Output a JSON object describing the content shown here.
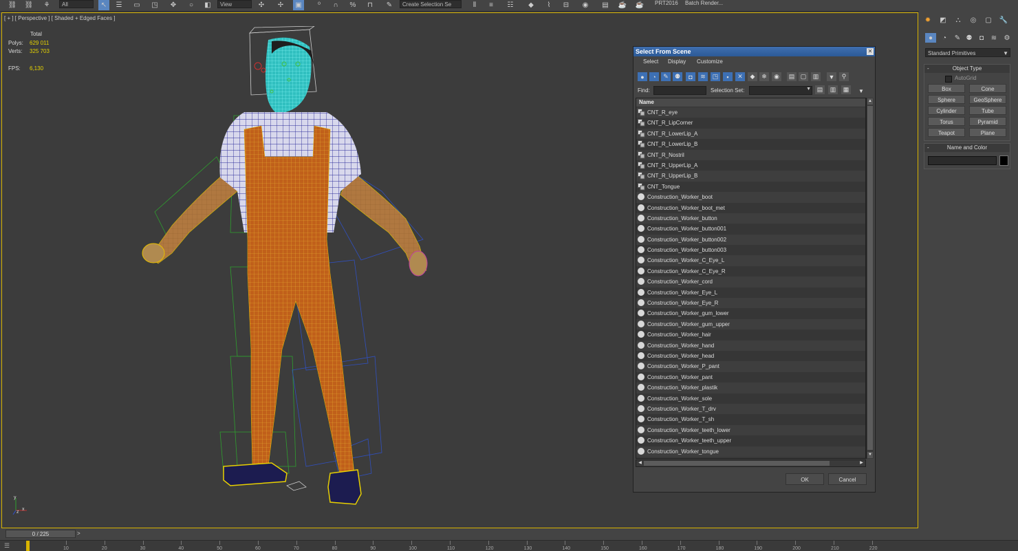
{
  "toolbar": {
    "selection_filter": "All",
    "view_dropdown": "View",
    "named_selection": "Create Selection Se",
    "prt_label": "PRT2016",
    "batch_render": "Batch Render..."
  },
  "viewport": {
    "label": "[ + ] [ Perspective ] [ Shaded + Edged Faces ]",
    "stats": {
      "total_label": "Total",
      "polys_label": "Polys:",
      "polys_value": "629 011",
      "verts_label": "Verts:",
      "verts_value": "325 703",
      "fps_label": "FPS:",
      "fps_value": "6,130"
    },
    "axis": {
      "y": "y",
      "x": "x",
      "z": "z"
    }
  },
  "command_panel": {
    "category_dropdown": "Standard Primitives",
    "object_type": {
      "title": "Object Type",
      "autogrid": "AutoGrid",
      "buttons": [
        "Box",
        "Cone",
        "Sphere",
        "GeoSphere",
        "Cylinder",
        "Tube",
        "Torus",
        "Pyramid",
        "Teapot",
        "Plane"
      ]
    },
    "name_and_color": {
      "title": "Name and Color"
    }
  },
  "dialog": {
    "title": "Select From Scene",
    "menus": [
      "Select",
      "Display",
      "Customize"
    ],
    "find_label": "Find:",
    "selection_set_label": "Selection Set:",
    "column_name": "Name",
    "items": [
      {
        "name": "CNT_R_eye",
        "kind": "helper"
      },
      {
        "name": "CNT_R_LipCorner",
        "kind": "helper"
      },
      {
        "name": "CNT_R_LowerLip_A",
        "kind": "helper"
      },
      {
        "name": "CNT_R_LowerLip_B",
        "kind": "helper"
      },
      {
        "name": "CNT_R_Nostril",
        "kind": "helper"
      },
      {
        "name": "CNT_R_UpperLip_A",
        "kind": "helper"
      },
      {
        "name": "CNT_R_UpperLip_B",
        "kind": "helper"
      },
      {
        "name": "CNT_Tongue",
        "kind": "helper"
      },
      {
        "name": "Construction_Worker_boot",
        "kind": "geo"
      },
      {
        "name": "Construction_Worker_boot_met",
        "kind": "geo"
      },
      {
        "name": "Construction_Worker_button",
        "kind": "geo"
      },
      {
        "name": "Construction_Worker_button001",
        "kind": "geo"
      },
      {
        "name": "Construction_Worker_button002",
        "kind": "geo"
      },
      {
        "name": "Construction_Worker_button003",
        "kind": "geo"
      },
      {
        "name": "Construction_Worker_C_Eye_L",
        "kind": "geo"
      },
      {
        "name": "Construction_Worker_C_Eye_R",
        "kind": "geo"
      },
      {
        "name": "Construction_Worker_cord",
        "kind": "geo"
      },
      {
        "name": "Construction_Worker_Eye_L",
        "kind": "geo"
      },
      {
        "name": "Construction_Worker_Eye_R",
        "kind": "geo"
      },
      {
        "name": "Construction_Worker_gum_lower",
        "kind": "geo"
      },
      {
        "name": "Construction_Worker_gum_upper",
        "kind": "geo"
      },
      {
        "name": "Construction_Worker_hair",
        "kind": "geo"
      },
      {
        "name": "Construction_Worker_hand",
        "kind": "geo"
      },
      {
        "name": "Construction_Worker_head",
        "kind": "geo"
      },
      {
        "name": "Construction_Worker_P_pant",
        "kind": "geo"
      },
      {
        "name": "Construction_Worker_pant",
        "kind": "geo"
      },
      {
        "name": "Construction_Worker_plastik",
        "kind": "geo"
      },
      {
        "name": "Construction_Worker_sole",
        "kind": "geo"
      },
      {
        "name": "Construction_Worker_T_drv",
        "kind": "geo"
      },
      {
        "name": "Construction_Worker_T_sh",
        "kind": "geo"
      },
      {
        "name": "Construction_Worker_teeth_lower",
        "kind": "geo"
      },
      {
        "name": "Construction_Worker_teeth_upper",
        "kind": "geo"
      },
      {
        "name": "Construction_Worker_tongue",
        "kind": "geo"
      }
    ],
    "ok_label": "OK",
    "cancel_label": "Cancel"
  },
  "timeline": {
    "frame_counter": "0 / 225",
    "ticks": [
      "10",
      "20",
      "30",
      "40",
      "50",
      "60",
      "70",
      "80",
      "90",
      "100",
      "110",
      "120",
      "130",
      "140",
      "150",
      "160",
      "170",
      "180",
      "190",
      "200",
      "210",
      "220"
    ]
  },
  "colors": {
    "viewport_border": "#d9b400",
    "stat_value": "#e6d300",
    "selection_blue": "#3d70b4",
    "overalls": "#c0601a",
    "wire_yellow": "#e8c000",
    "shirt_wire": "#2a2a9a",
    "head_cyan": "#2ad0d0"
  }
}
